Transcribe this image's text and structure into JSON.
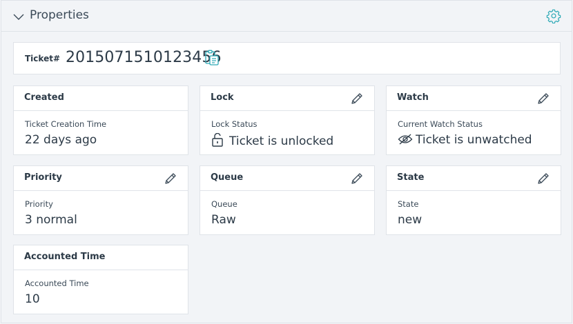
{
  "panel": {
    "title": "Properties"
  },
  "ticket": {
    "label": "Ticket#",
    "number": "2015071510123456"
  },
  "cards": {
    "created": {
      "title": "Created",
      "label": "Ticket Creation Time",
      "value": "22 days ago"
    },
    "lock": {
      "title": "Lock",
      "label": "Lock Status",
      "value": "Ticket is unlocked"
    },
    "watch": {
      "title": "Watch",
      "label": "Current Watch Status",
      "value": "Ticket is unwatched"
    },
    "priority": {
      "title": "Priority",
      "label": "Priority",
      "value": "3 normal"
    },
    "queue": {
      "title": "Queue",
      "label": "Queue",
      "value": "Raw"
    },
    "state": {
      "title": "State",
      "label": "State",
      "value": "new"
    },
    "accounted": {
      "title": "Accounted Time",
      "label": "Accounted Time",
      "value": "10"
    }
  },
  "icons": {
    "collapse": "chevron-down-icon",
    "settings": "gear-icon",
    "copy": "clipboard-icon",
    "edit": "pencil-icon",
    "lock": "unlock-icon",
    "watch": "eye-slash-icon"
  },
  "colors": {
    "accent": "#2aa8b5",
    "text": "#2c3a47",
    "border": "#dfe3e8"
  }
}
